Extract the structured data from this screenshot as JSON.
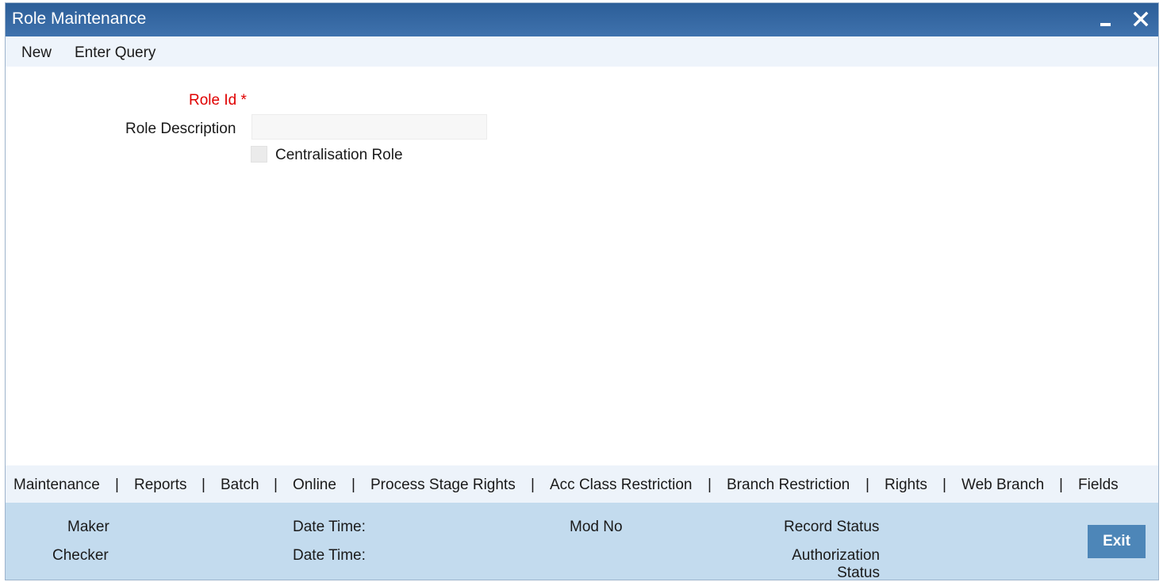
{
  "window": {
    "title": "Role Maintenance"
  },
  "menu": {
    "items": [
      {
        "label": "New"
      },
      {
        "label": "Enter Query"
      }
    ]
  },
  "form": {
    "role_id": {
      "label": "Role Id",
      "required_mark": "*",
      "value": ""
    },
    "role_description": {
      "label": "Role Description",
      "value": ""
    },
    "centralisation_role": {
      "label": "Centralisation Role",
      "checked": false
    }
  },
  "tabs": [
    {
      "label": "Maintenance"
    },
    {
      "label": "Reports"
    },
    {
      "label": "Batch"
    },
    {
      "label": "Online"
    },
    {
      "label": "Process Stage Rights"
    },
    {
      "label": "Acc Class Restriction"
    },
    {
      "label": "Branch Restriction"
    },
    {
      "label": "Rights"
    },
    {
      "label": "Web Branch"
    },
    {
      "label": "Fields"
    }
  ],
  "tab_separator": "|",
  "footer": {
    "maker": "Maker",
    "checker": "Checker",
    "maker_date_time": "Date Time:",
    "checker_date_time": "Date Time:",
    "mod_no": "Mod No",
    "record_status": "Record Status",
    "authorization_status_line1": "Authorization",
    "authorization_status_line2": "Status",
    "exit_label": "Exit"
  },
  "colors": {
    "title_bar": "#2c5e98",
    "required_label": "#e00000",
    "footer_bg": "#c3dbee",
    "exit_button": "#4d86b8"
  },
  "icons": {
    "minimize": "minimize-icon",
    "close": "close-icon"
  }
}
